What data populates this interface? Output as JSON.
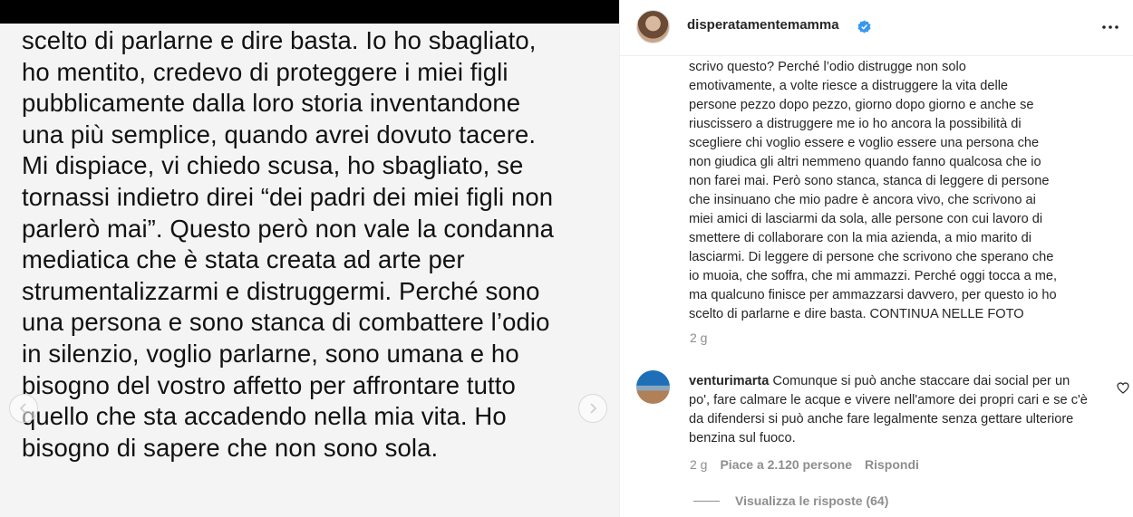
{
  "post": {
    "slide_text": "scelto di parlarne e dire basta. Io ho sbagliato,\nho mentito, credevo di proteggere  i miei figli\npubblicamente dalla loro storia inventandone\nuna più semplice, quando avrei dovuto tacere.\nMi dispiace, vi chiedo scusa, ho sbagliato, se\ntornassi indietro direi “dei padri dei miei figli non\nparlerò mai”. Questo però non vale la condanna\nmediatica che è stata creata ad arte per\nstrumentalizzarmi e distruggermi. Perché sono\nuna persona e sono stanca di combattere l’odio\nin silenzio, voglio parlarne, sono umana e ho\nbisogno del vostro affetto per affrontare tutto\nquello che sta accadendo nella mia vita. Ho\nbisogno di sapere che non sono sola."
  },
  "header": {
    "username": "disperatamentemamma",
    "verified_color": "#3897f0"
  },
  "caption": {
    "text": "scrivo questo? Perché l’odio distrugge non solo\nemotivamente, a volte riesce a distruggere la vita delle\npersone pezzo dopo pezzo, giorno dopo giorno e anche se\nriuscissero a distruggere me io ho ancora la possibilità di\nscegliere chi voglio essere e voglio essere una persona che\nnon giudica gli altri nemmeno quando fanno qualcosa che io\nnon farei mai. Però sono stanca, stanca di leggere di persone\nche insinuano che mio padre è ancora vivo, che scrivono ai\nmiei amici di lasciarmi da sola, alle persone con cui lavoro di\nsmettere di collaborare con la mia azienda, a mio marito di\nlasciarmi. Di leggere di persone che scrivono che sperano che\nio muoia, che soffra, che mi ammazzi. Perché oggi tocca a me,\nma qualcuno finisce per ammazzarsi davvero, per questo io ho\nscelto di parlarne e dire basta. CONTINUA NELLE FOTO",
    "time": "2 g"
  },
  "comment": {
    "username": "venturimarta",
    "text": " Comunque si può anche staccare dai social per un po', fare calmare le acque e vivere nell'amore dei propri cari e se c'è da difendersi si può anche fare legalmente senza gettare ulteriore benzina sul fuoco.",
    "time": "2 g",
    "likes": "Piace a 2.120 persone",
    "reply_label": "Rispondi",
    "view_replies": "Visualizza le risposte (64)"
  }
}
